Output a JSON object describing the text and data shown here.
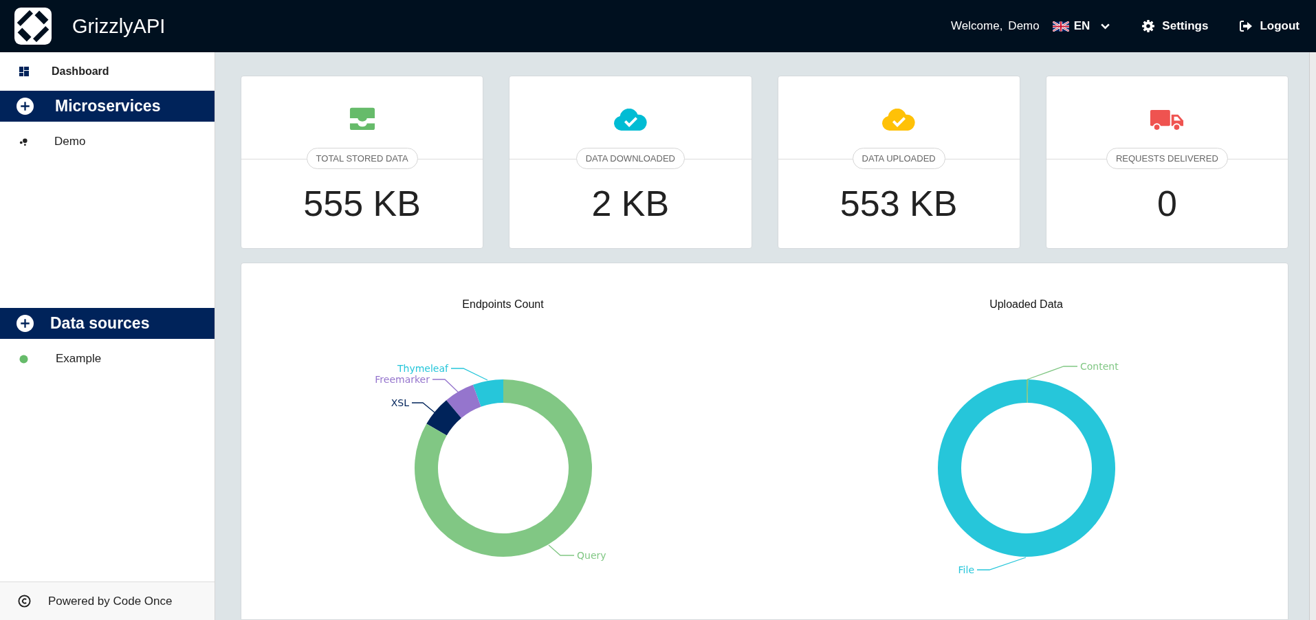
{
  "header": {
    "title": "GrizzlyAPI",
    "welcome": "Welcome,",
    "user": "Demo",
    "language": "EN",
    "settings": "Settings",
    "logout": "Logout"
  },
  "sidebar": {
    "dashboard": "Dashboard",
    "sections": [
      {
        "title": "Microservices",
        "items": [
          {
            "label": "Demo",
            "kind": "service"
          }
        ]
      },
      {
        "title": "Data sources",
        "items": [
          {
            "label": "Example",
            "kind": "source"
          }
        ]
      }
    ],
    "footer": "Powered by Code Once"
  },
  "stats": [
    {
      "kind": "stored",
      "label": "TOTAL STORED DATA",
      "value": "555 KB"
    },
    {
      "kind": "downloaded",
      "label": "DATA DOWNLOADED",
      "value": "2 KB"
    },
    {
      "kind": "uploaded",
      "label": "DATA UPLOADED",
      "value": "553 KB"
    },
    {
      "kind": "requests",
      "label": "REQUESTS DELIVERED",
      "value": "0"
    }
  ],
  "charts": [
    {
      "title": "Endpoints Count",
      "slices": [
        {
          "label": "Thymeleaf",
          "color": "#26c6da"
        },
        {
          "label": "Freemarker",
          "color": "#9575cd"
        },
        {
          "label": "XSL",
          "color": "#00235a"
        },
        {
          "label": "Query",
          "color": "#81c784"
        }
      ]
    },
    {
      "title": "Uploaded Data",
      "slices": [
        {
          "label": "Content",
          "color": "#81c784"
        },
        {
          "label": "File",
          "color": "#26c6da"
        }
      ]
    }
  ]
}
